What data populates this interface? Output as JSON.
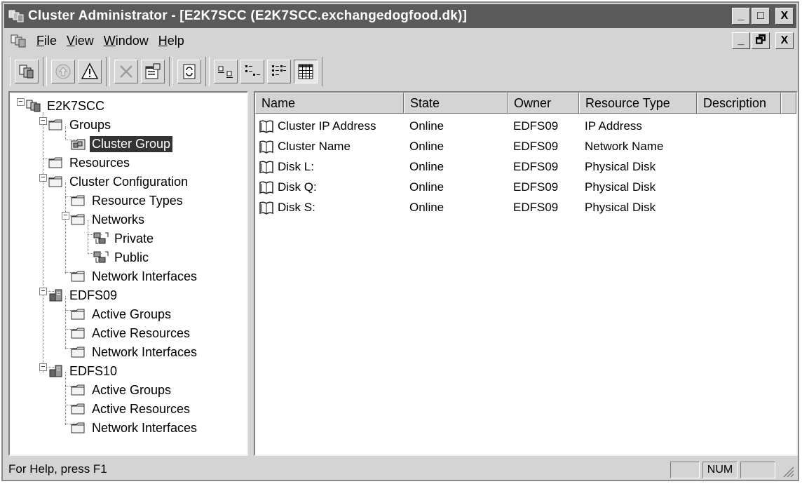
{
  "window": {
    "title": "Cluster Administrator - [E2K7SCC (E2K7SCC.exchangedogfood.dk)]",
    "caption_buttons": [
      "_",
      "□",
      "X"
    ],
    "mdi_buttons": [
      "_",
      "🗗",
      "X"
    ]
  },
  "menu": {
    "items": [
      {
        "label": "File",
        "accel": "F"
      },
      {
        "label": "View",
        "accel": "V"
      },
      {
        "label": "Window",
        "accel": "W"
      },
      {
        "label": "Help",
        "accel": "H"
      }
    ]
  },
  "toolbar": {
    "icons": [
      "open-connection-icon",
      "bring-online-icon",
      "take-offline-icon",
      "delete-icon",
      "properties-icon",
      "refresh-icon",
      "large-icons-icon",
      "small-icons-icon",
      "list-view-icon",
      "details-view-icon"
    ]
  },
  "tree": {
    "nodes": [
      {
        "label": "E2K7SCC",
        "icon": "cluster-icon"
      },
      {
        "label": "Groups",
        "icon": "folder-icon"
      },
      {
        "label": "Cluster Group",
        "icon": "group-icon",
        "selected": true
      },
      {
        "label": "Resources",
        "icon": "folder-icon"
      },
      {
        "label": "Cluster Configuration",
        "icon": "folder-icon"
      },
      {
        "label": "Resource Types",
        "icon": "folder-icon"
      },
      {
        "label": "Networks",
        "icon": "folder-icon"
      },
      {
        "label": "Private",
        "icon": "network-icon"
      },
      {
        "label": "Public",
        "icon": "network-icon"
      },
      {
        "label": "Network Interfaces",
        "icon": "folder-icon"
      },
      {
        "label": "EDFS09",
        "icon": "server-icon"
      },
      {
        "label": "Active Groups",
        "icon": "folder-icon"
      },
      {
        "label": "Active Resources",
        "icon": "folder-icon"
      },
      {
        "label": "Network Interfaces",
        "icon": "folder-icon"
      },
      {
        "label": "EDFS10",
        "icon": "server-icon"
      },
      {
        "label": "Active Groups",
        "icon": "folder-icon"
      },
      {
        "label": "Active Resources",
        "icon": "folder-icon"
      },
      {
        "label": "Network Interfaces",
        "icon": "folder-icon"
      }
    ]
  },
  "list": {
    "columns": [
      "Name",
      "State",
      "Owner",
      "Resource Type",
      "Description"
    ],
    "rows": [
      {
        "name": "Cluster IP Address",
        "state": "Online",
        "owner": "EDFS09",
        "type": "IP Address",
        "description": ""
      },
      {
        "name": "Cluster Name",
        "state": "Online",
        "owner": "EDFS09",
        "type": "Network Name",
        "description": ""
      },
      {
        "name": "Disk L:",
        "state": "Online",
        "owner": "EDFS09",
        "type": "Physical Disk",
        "description": ""
      },
      {
        "name": "Disk Q:",
        "state": "Online",
        "owner": "EDFS09",
        "type": "Physical Disk",
        "description": ""
      },
      {
        "name": "Disk S:",
        "state": "Online",
        "owner": "EDFS09",
        "type": "Physical Disk",
        "description": ""
      }
    ]
  },
  "status": {
    "message": "For Help, press F1",
    "num": "NUM"
  }
}
